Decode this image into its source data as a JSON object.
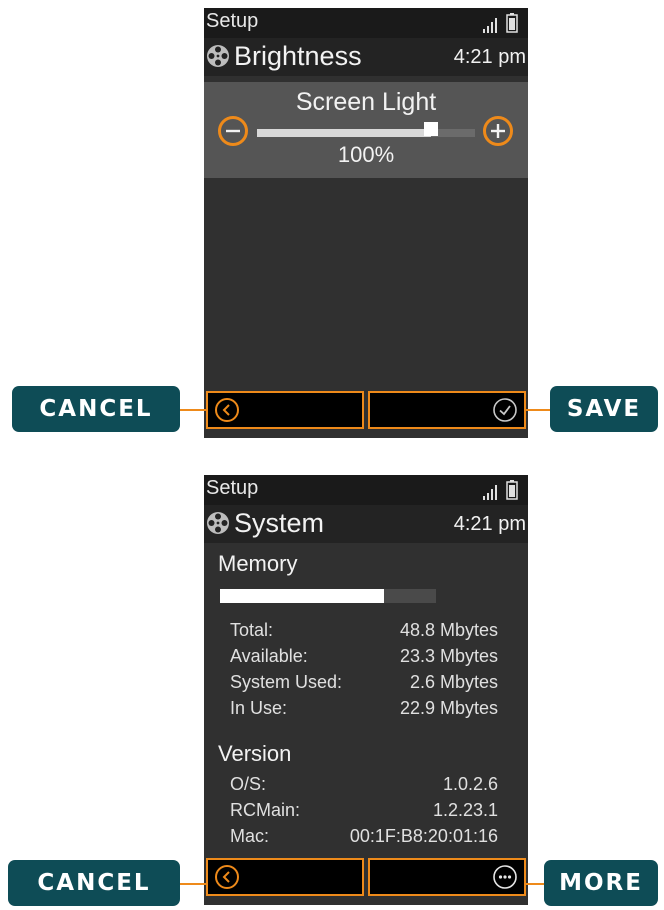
{
  "colors": {
    "accent": "#ee8a1a",
    "callout_bg": "#0e4c56",
    "screen_bg": "#303030"
  },
  "screen1": {
    "status": {
      "title": "Setup",
      "signal_icon": "signal-icon",
      "battery_icon": "battery-icon"
    },
    "header": {
      "icon": "film-reel-icon",
      "title": "Brightness",
      "time": "4:21 pm"
    },
    "screen_light": {
      "label": "Screen Light",
      "value_text": "100%",
      "slider_level": 0.8,
      "minus_icon": "minus-icon",
      "plus_icon": "plus-icon"
    },
    "softkeys": {
      "left_icon": "back-chevron-icon",
      "right_icon": "checkmark-icon"
    },
    "callouts": {
      "left": "CANCEL",
      "right": "SAVE"
    }
  },
  "screen2": {
    "status": {
      "title": "Setup",
      "signal_icon": "signal-icon",
      "battery_icon": "battery-icon"
    },
    "header": {
      "icon": "film-reel-icon",
      "title": "System",
      "time": "4:21 pm"
    },
    "memory": {
      "heading": "Memory",
      "usage_fraction": 0.76,
      "rows": [
        {
          "label": "Total:",
          "value": "48.8 Mbytes"
        },
        {
          "label": "Available:",
          "value": "23.3 Mbytes"
        },
        {
          "label": "System Used:",
          "value": "2.6 Mbytes"
        },
        {
          "label": "In Use:",
          "value": "22.9 Mbytes"
        }
      ]
    },
    "version": {
      "heading": "Version",
      "rows": [
        {
          "label": "O/S:",
          "value": "1.0.2.6"
        },
        {
          "label": "RCMain:",
          "value": "1.2.23.1"
        },
        {
          "label": "Mac:",
          "value": "00:1F:B8:20:01:16"
        }
      ]
    },
    "softkeys": {
      "left_icon": "back-chevron-icon",
      "right_icon": "more-dots-icon"
    },
    "callouts": {
      "left": "CANCEL",
      "right": "MORE"
    }
  }
}
